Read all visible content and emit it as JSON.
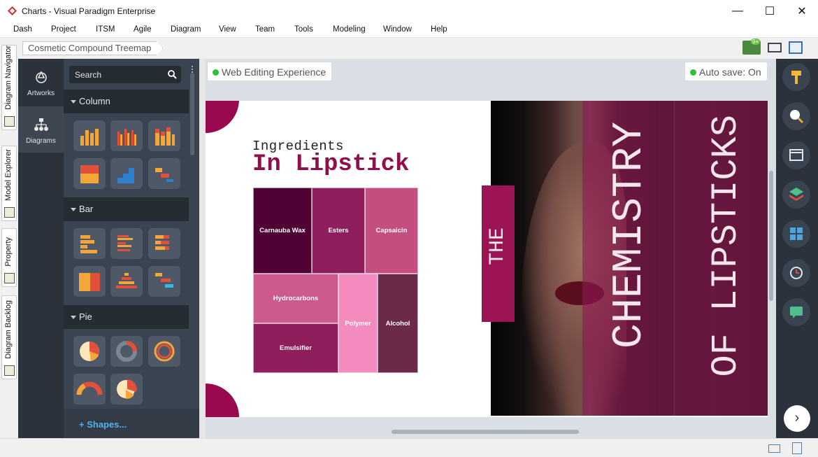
{
  "window": {
    "title": "Charts - Visual Paradigm Enterprise",
    "controls": [
      "—",
      "☐",
      "✕"
    ]
  },
  "menu": [
    "Dash",
    "Project",
    "ITSM",
    "Agile",
    "Diagram",
    "View",
    "Team",
    "Tools",
    "Modeling",
    "Window",
    "Help"
  ],
  "left_tabs": [
    "Diagram Navigator",
    "Model Explorer",
    "Property",
    "Diagram Backlog"
  ],
  "breadcrumb": "Cosmetic Compound Treemap",
  "toolbar": {
    "notification_badge": "9+"
  },
  "palette": {
    "rail": [
      {
        "label": "Artworks",
        "icon": "artworks-icon"
      },
      {
        "label": "Diagrams",
        "icon": "diagrams-icon"
      }
    ],
    "search_placeholder": "Search",
    "categories": [
      "Column",
      "Bar",
      "Pie"
    ],
    "shapes_link": "+ Shapes..."
  },
  "canvas": {
    "web_editing": "Web Editing Experience",
    "autosave": "Auto save: On"
  },
  "slide": {
    "heading_small": "Ingredients",
    "heading_large": "In Lipstick",
    "the_label": "THE",
    "title_line1": "CHEMISTRY",
    "title_line2": "OF LIPSTICKS",
    "treemap": [
      {
        "label": "Carnauba Wax",
        "color": "#4f0133"
      },
      {
        "label": "Esters",
        "color": "#8e1e5c"
      },
      {
        "label": "Capsaicin",
        "color": "#c44e80"
      },
      {
        "label": "Hydrocarbons",
        "color": "#cc5a8c"
      },
      {
        "label": "Polymer",
        "color": "#f48bbf"
      },
      {
        "label": "Alcohol",
        "color": "#6c2a4a"
      },
      {
        "label": "Emulsifier",
        "color": "#8e1e5c"
      }
    ]
  },
  "colors": {
    "accent": "#8e0f4c",
    "online_dot": "#2fbf3c"
  }
}
